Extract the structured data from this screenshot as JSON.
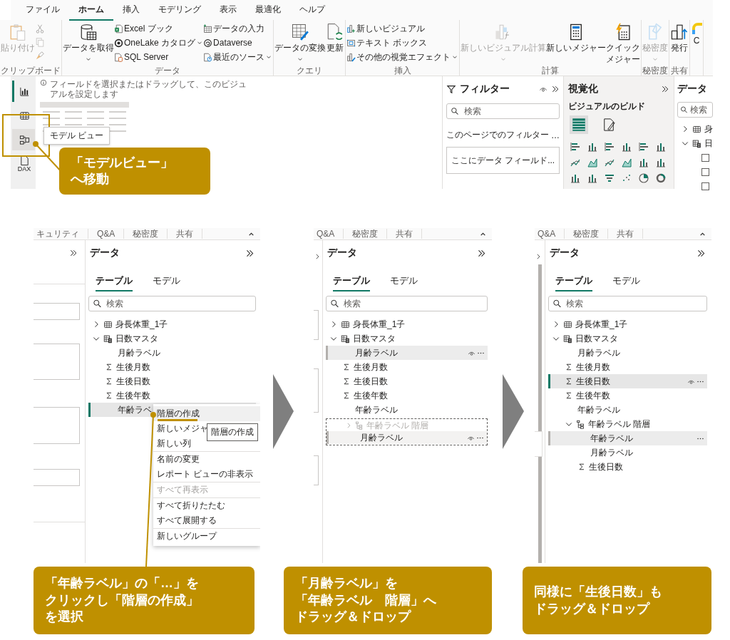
{
  "ribbon": {
    "tabs": [
      {
        "label": "ファイル",
        "selected": false
      },
      {
        "label": "ホーム",
        "selected": true
      },
      {
        "label": "挿入",
        "selected": false
      },
      {
        "label": "モデリング",
        "selected": false
      },
      {
        "label": "表示",
        "selected": false
      },
      {
        "label": "最適化",
        "selected": false
      },
      {
        "label": "ヘルプ",
        "selected": false
      }
    ],
    "groups": [
      {
        "label": "クリップボード",
        "items": [
          {
            "kind": "large",
            "label": "貼り付け",
            "disabled": true,
            "dropdown": false
          },
          {
            "kind": "icon-stack"
          }
        ]
      },
      {
        "label": "データ",
        "items": [
          {
            "kind": "large",
            "label": "データを取得",
            "disabled": false,
            "dropdown": true
          },
          {
            "kind": "stack",
            "items": [
              {
                "label": "Excel ブック",
                "disabled": false,
                "dropdown": false
              },
              {
                "label": "OneLake カタログ",
                "disabled": false,
                "dropdown": true
              },
              {
                "label": "SQL Server",
                "disabled": false,
                "dropdown": false
              }
            ]
          },
          {
            "kind": "stack",
            "items": [
              {
                "label": "データの入力",
                "disabled": false,
                "dropdown": false
              },
              {
                "label": "Dataverse",
                "disabled": false,
                "dropdown": false
              },
              {
                "label": "最近のソース",
                "disabled": false,
                "dropdown": true
              }
            ]
          }
        ]
      },
      {
        "label": "クエリ",
        "items": [
          {
            "kind": "large",
            "label": "データの変換",
            "disabled": false,
            "dropdown": true
          },
          {
            "kind": "large",
            "label": "更新",
            "disabled": false,
            "dropdown": false
          }
        ]
      },
      {
        "label": "挿入",
        "items": [
          {
            "kind": "stack",
            "items": [
              {
                "label": "新しいビジュアル",
                "disabled": false,
                "dropdown": false
              },
              {
                "label": "テキスト ボックス",
                "disabled": false,
                "dropdown": false
              },
              {
                "label": "その他の視覚エフェクト",
                "disabled": false,
                "dropdown": true
              }
            ]
          }
        ]
      },
      {
        "label": "計算",
        "items": [
          {
            "kind": "large",
            "label": "新しいビジュアル計算",
            "disabled": true,
            "dropdown": true
          },
          {
            "kind": "large",
            "label": "新しいメジャー",
            "disabled": false,
            "dropdown": false
          },
          {
            "kind": "large",
            "label": "クイックメジャー",
            "disabled": false,
            "dropdown": false
          }
        ]
      },
      {
        "label": "秘密度",
        "items": [
          {
            "kind": "large",
            "label": "秘密度",
            "disabled": true,
            "dropdown": true
          }
        ]
      },
      {
        "label": "共有",
        "items": [
          {
            "kind": "large",
            "label": "発行",
            "disabled": false,
            "dropdown": false
          }
        ]
      },
      {
        "items": [
          {
            "kind": "large",
            "label": "C",
            "disabled": false,
            "dropdown": false
          }
        ]
      }
    ]
  },
  "nav_rail": {
    "items": [
      {
        "selected": true,
        "hovered": false
      },
      {
        "selected": false,
        "hovered": false
      },
      {
        "selected": false,
        "hovered": true
      },
      {
        "selected": false,
        "hovered": false,
        "label": "DAX"
      }
    ]
  },
  "canvas": {
    "visual_hint": "フィールドを選択またはドラッグして、このビジュアルを設定します"
  },
  "model_view_tooltip": "モデル ビュー",
  "top_callout": [
    "「モデルビュー」",
    "へ移動"
  ],
  "filter_pane": {
    "title": "フィルター",
    "search": {
      "placeholder": "検索"
    },
    "section": "このページでのフィルター",
    "section_more": "…",
    "drop_hint": "ここにデータ フィールド..."
  },
  "viz_pane": {
    "title": "視覚化",
    "subtitle": "ビジュアルのビルド",
    "modes": [
      {
        "selected": true
      },
      {
        "selected": false
      }
    ]
  },
  "data_pane": {
    "title": "データ",
    "search": {
      "placeholder": "検索"
    },
    "tree": [
      {
        "label": "身",
        "kind": "table",
        "expanded": false,
        "selected": false,
        "hovered": false
      },
      {
        "label": "日",
        "kind": "calc-table",
        "expanded": true,
        "selected": false,
        "hovered": false,
        "children": [
          {
            "kind": "checkbox",
            "checked": false
          },
          {
            "kind": "checkbox",
            "checked": false
          },
          {
            "kind": "checkbox",
            "checked": false
          }
        ]
      }
    ]
  },
  "steps": [
    {
      "ribbon_strip": [
        "キュリティ",
        "Q&A",
        "秘密度",
        "共有"
      ],
      "data_pane": {
        "title": "データ",
        "tabs": [
          {
            "label": "テーブル",
            "selected": true
          },
          {
            "label": "モデル",
            "selected": false
          }
        ],
        "search": {
          "placeholder": "検索"
        },
        "tree": [
          {
            "label": "身長体重_1子",
            "kind": "table",
            "expanded": false,
            "selected": false,
            "hovered": false,
            "eye": false,
            "more": false
          },
          {
            "label": "日数マスタ",
            "kind": "calc-table",
            "expanded": true,
            "selected": false,
            "hovered": false,
            "eye": false,
            "more": false,
            "children": [
              {
                "label": "月齢ラベル",
                "kind": "column",
                "selected": false,
                "hovered": false,
                "eye": false,
                "more": false
              },
              {
                "label": "生後月数",
                "kind": "measure",
                "selected": false,
                "hovered": false,
                "eye": false,
                "more": false
              },
              {
                "label": "生後日数",
                "kind": "measure",
                "selected": false,
                "hovered": false,
                "eye": false,
                "more": false
              },
              {
                "label": "生後年数",
                "kind": "measure",
                "selected": false,
                "hovered": false,
                "eye": false,
                "more": false
              },
              {
                "label": "年齢ラベ",
                "kind": "column",
                "selected": true,
                "hovered": false,
                "eye": false,
                "more": false
              }
            ]
          }
        ]
      },
      "context_menu": [
        {
          "kind": "item",
          "label": "階層の作成",
          "highlighted": true,
          "disabled": false
        },
        {
          "kind": "item",
          "label": "新しいメジャ",
          "highlighted": false,
          "disabled": false
        },
        {
          "kind": "item",
          "label": "新しい列",
          "highlighted": false,
          "disabled": false
        },
        {
          "kind": "separator"
        },
        {
          "kind": "item",
          "label": "名前の変更",
          "highlighted": false,
          "disabled": false
        },
        {
          "kind": "item",
          "label": "レポート ビューの非表示",
          "highlighted": false,
          "disabled": false
        },
        {
          "kind": "separator"
        },
        {
          "kind": "item",
          "label": "すべて再表示",
          "highlighted": false,
          "disabled": true
        },
        {
          "kind": "separator"
        },
        {
          "kind": "item",
          "label": "すべて折りたたむ",
          "highlighted": false,
          "disabled": false
        },
        {
          "kind": "item",
          "label": "すべて展開する",
          "highlighted": false,
          "disabled": false
        },
        {
          "kind": "separator"
        },
        {
          "kind": "item",
          "label": "新しいグループ",
          "highlighted": false,
          "disabled": false
        }
      ],
      "tooltip": "階層の作成",
      "callout": [
        "「年齢ラベル」の「…」を",
        "クリックし「階層の作成」",
        "を選択"
      ]
    },
    {
      "ribbon_strip": [
        "Q&A",
        "秘密度",
        "共有"
      ],
      "data_pane": {
        "title": "データ",
        "tabs": [
          {
            "label": "テーブル",
            "selected": true
          },
          {
            "label": "モデル",
            "selected": false
          }
        ],
        "search": {
          "placeholder": "検索"
        },
        "tree": [
          {
            "label": "身長体重_1子",
            "kind": "table",
            "expanded": false,
            "selected": false,
            "hovered": false,
            "eye": false,
            "more": false
          },
          {
            "label": "日数マスタ",
            "kind": "calc-table",
            "expanded": true,
            "selected": false,
            "hovered": false,
            "eye": false,
            "more": false,
            "children": [
              {
                "label": "月齢ラベル",
                "kind": "column",
                "selected": false,
                "hovered": true,
                "eye": true,
                "more": true
              },
              {
                "label": "生後月数",
                "kind": "measure",
                "selected": false,
                "hovered": false,
                "eye": false,
                "more": false
              },
              {
                "label": "生後日数",
                "kind": "measure",
                "selected": false,
                "hovered": false,
                "eye": false,
                "more": false
              },
              {
                "label": "生後年数",
                "kind": "measure",
                "selected": false,
                "hovered": false,
                "eye": false,
                "more": false
              },
              {
                "label": "年齢ラベル",
                "kind": "column",
                "selected": false,
                "hovered": false,
                "eye": false,
                "more": false
              },
              {
                "label": "年齢ラベル 階層",
                "kind": "drop-ghost",
                "drag_label": "月齢ラベル",
                "eye": true,
                "more": true
              }
            ]
          }
        ]
      },
      "callout": [
        "「月齢ラベル」を",
        "「年齢ラベル　階層」へ",
        "ドラッグ＆ドロップ"
      ]
    },
    {
      "ribbon_strip": [
        "Q&A",
        "秘密度",
        "共有"
      ],
      "data_pane": {
        "title": "データ",
        "tabs": [
          {
            "label": "テーブル",
            "selected": true
          },
          {
            "label": "モデル",
            "selected": false
          }
        ],
        "search": {
          "placeholder": "検索"
        },
        "tree": [
          {
            "label": "身長体重_1子",
            "kind": "table",
            "expanded": false,
            "selected": false,
            "hovered": false,
            "eye": false,
            "more": false
          },
          {
            "label": "日数マスタ",
            "kind": "calc-table",
            "expanded": true,
            "selected": false,
            "hovered": false,
            "eye": false,
            "more": false,
            "children": [
              {
                "label": "月齢ラベル",
                "kind": "column",
                "selected": false,
                "hovered": false,
                "eye": false,
                "more": false
              },
              {
                "label": "生後月数",
                "kind": "measure",
                "selected": false,
                "hovered": false,
                "eye": false,
                "more": false
              },
              {
                "label": "生後日数",
                "kind": "measure",
                "selected": true,
                "hovered": false,
                "eye": true,
                "more": true
              },
              {
                "label": "生後年数",
                "kind": "measure",
                "selected": false,
                "hovered": false,
                "eye": false,
                "more": false
              },
              {
                "label": "年齢ラベル",
                "kind": "column",
                "selected": false,
                "hovered": false,
                "eye": false,
                "more": false
              },
              {
                "label": "年齢ラベル 階層",
                "kind": "hierarchy",
                "expanded": true,
                "selected": false,
                "hovered": false,
                "eye": false,
                "more": false,
                "children": [
                  {
                    "label": "年齢ラベル",
                    "kind": "column",
                    "selected": false,
                    "hovered": true,
                    "eye": false,
                    "more": true
                  },
                  {
                    "label": "月齢ラベル",
                    "kind": "column",
                    "selected": false,
                    "hovered": false,
                    "eye": false,
                    "more": false
                  },
                  {
                    "label": "生後日数",
                    "kind": "measure",
                    "selected": false,
                    "hovered": false,
                    "eye": false,
                    "more": false
                  }
                ]
              }
            ]
          }
        ]
      },
      "callout": [
        "同様に「生後日数」も",
        "ドラッグ＆ドロップ"
      ]
    }
  ]
}
